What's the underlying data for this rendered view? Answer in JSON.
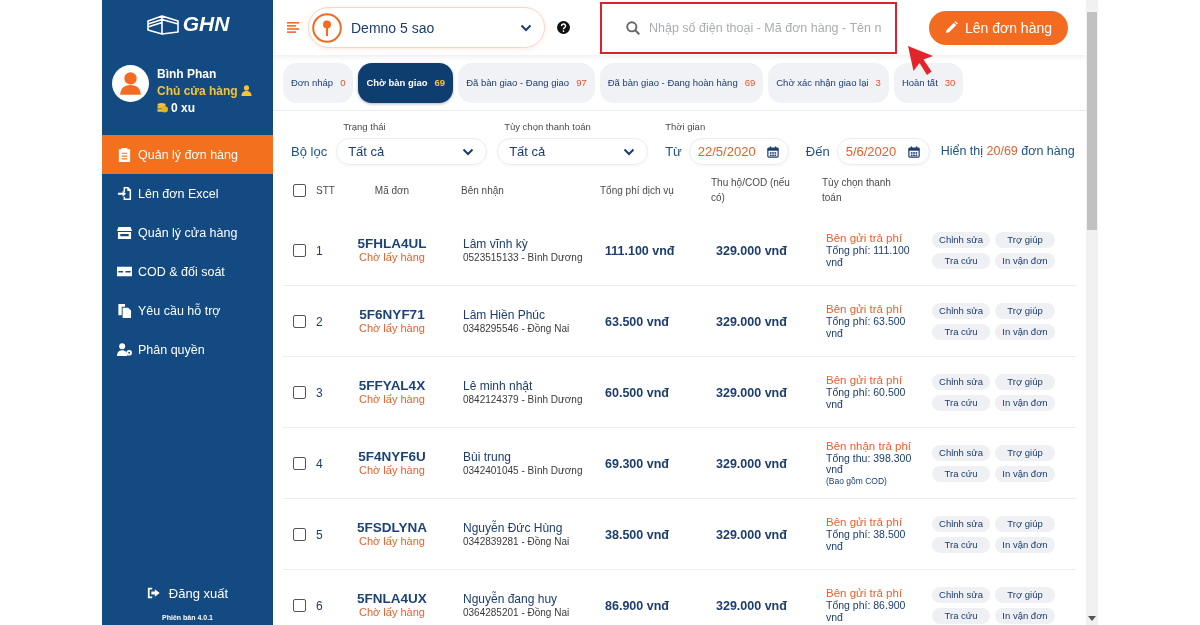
{
  "sidebar": {
    "logo": "GHN",
    "user": {
      "name": "Bình Phan",
      "role": "Chủ cửa hàng",
      "coins": "0 xu"
    },
    "menu": [
      {
        "label": "Quản lý đơn hàng",
        "selected": true
      },
      {
        "label": "Lên đơn Excel",
        "selected": false
      },
      {
        "label": "Quản lý cửa hàng",
        "selected": false
      },
      {
        "label": "COD & đối soát",
        "selected": false
      },
      {
        "label": "Yêu cầu hỗ trợ",
        "selected": false
      },
      {
        "label": "Phân quyền",
        "selected": false
      }
    ],
    "logout": "Đăng xuất",
    "version": "Phiên bản 4.0.1"
  },
  "header": {
    "store": "Demno 5 sao",
    "search": {
      "placeholder": "Nhập số điện thoại - Mã đơn hàng - Tên n"
    },
    "create_button": "Lên đơn hàng"
  },
  "tabs": [
    {
      "label": "Đơn nháp",
      "count": "0",
      "selected": false
    },
    {
      "label": "Chờ bàn giao",
      "count": "69",
      "selected": true
    },
    {
      "label": "Đã bàn giao - Đang giao",
      "count": "97",
      "selected": false
    },
    {
      "label": "Đã bàn giao - Đang hoàn hàng",
      "count": "69",
      "selected": false
    },
    {
      "label": "Chờ xác nhận giao lại",
      "count": "3",
      "selected": false
    },
    {
      "label": "Hoàn tất",
      "count": "30",
      "selected": false
    }
  ],
  "filters": {
    "title": "Bộ lọc",
    "status": {
      "label": "Trạng thái",
      "value": "Tất cả"
    },
    "payment": {
      "label": "Tùy chọn thanh toán",
      "value": "Tất cả"
    },
    "time": {
      "label": "Thời gian",
      "from_label": "Từ",
      "from": "22/5/2020",
      "to_label": "Đến",
      "to": "5/6/2020"
    },
    "summary": {
      "prefix": "Hiển thị",
      "count": "20/69",
      "suffix": "đơn hàng"
    }
  },
  "table": {
    "all_checked": false,
    "columns": [
      "STT",
      "Mã đơn",
      "Bên nhận",
      "Tổng phí dịch vụ",
      "Thu hộ/COD (nếu có)",
      "Tùy chọn thanh toán"
    ],
    "rows": [
      {
        "checked": false,
        "number": "1",
        "code": "5FHLA4UL",
        "status": "Chờ lấy hàng",
        "recipient": "Lâm vĩnh kỳ",
        "contact": "0523515133 - Bình Dương",
        "fee": "111.100 vnđ",
        "cod": "329.000 vnđ",
        "payer": "Bên gửi trả phí",
        "total": "Tổng phí: 111.100 vnđ",
        "actions": [
          "Chỉnh sửa",
          "Trợ giúp",
          "Tra cứu",
          "In vận đơn"
        ]
      },
      {
        "checked": false,
        "number": "2",
        "code": "5F6NYF71",
        "status": "Chờ lấy hàng",
        "recipient": "Lâm Hiền Phúc",
        "contact": "0348295546 - Đồng Nai",
        "fee": "63.500 vnđ",
        "cod": "329.000 vnđ",
        "payer": "Bên gửi trả phí",
        "total": "Tổng phí: 63.500 vnđ",
        "actions": [
          "Chỉnh sửa",
          "Trợ giúp",
          "Tra cứu",
          "In vận đơn"
        ]
      },
      {
        "checked": false,
        "number": "3",
        "code": "5FFYAL4X",
        "status": "Chờ lấy hàng",
        "recipient": "Lê minh nhật",
        "contact": "0842124379 - Bình Dương",
        "fee": "60.500 vnđ",
        "cod": "329.000 vnđ",
        "payer": "Bên gửi trả phí",
        "total": "Tổng phí: 60.500 vnđ",
        "actions": [
          "Chỉnh sửa",
          "Trợ giúp",
          "Tra cứu",
          "In vận đơn"
        ]
      },
      {
        "checked": false,
        "number": "4",
        "code": "5F4NYF6U",
        "status": "Chờ lấy hàng",
        "recipient": "Bùi trung",
        "contact": "0342401045 - Bình Dương",
        "fee": "69.300 vnđ",
        "cod": "329.000 vnđ",
        "payer": "Bên nhận trả phí",
        "total": "Tổng thu: 398.300 vnđ",
        "note": "(Bao gồm COD)",
        "actions": [
          "Chỉnh sửa",
          "Trợ giúp",
          "Tra cứu",
          "In vận đơn"
        ]
      },
      {
        "checked": false,
        "number": "5",
        "code": "5FSDLYNA",
        "status": "Chờ lấy hàng",
        "recipient": "Nguyễn Đức Hùng",
        "contact": "0342839281 - Đồng Nai",
        "fee": "38.500 vnđ",
        "cod": "329.000 vnđ",
        "payer": "Bên gửi trả phí",
        "total": "Tổng phí: 38.500 vnđ",
        "actions": [
          "Chỉnh sửa",
          "Trợ giúp",
          "Tra cứu",
          "In vận đơn"
        ]
      },
      {
        "checked": false,
        "number": "6",
        "code": "5FNLA4UX",
        "status": "Chờ lấy hàng",
        "recipient": "Nguyễn đang huy",
        "contact": "0364285201 - Đồng Nai",
        "fee": "86.900 vnđ",
        "cod": "329.000 vnđ",
        "payer": "Bên gửi trả phí",
        "total": "Tổng phí: 86.900 vnđ",
        "actions": [
          "Chỉnh sửa",
          "Trợ giúp",
          "Tra cứu",
          "In vận đơn"
        ]
      }
    ]
  }
}
